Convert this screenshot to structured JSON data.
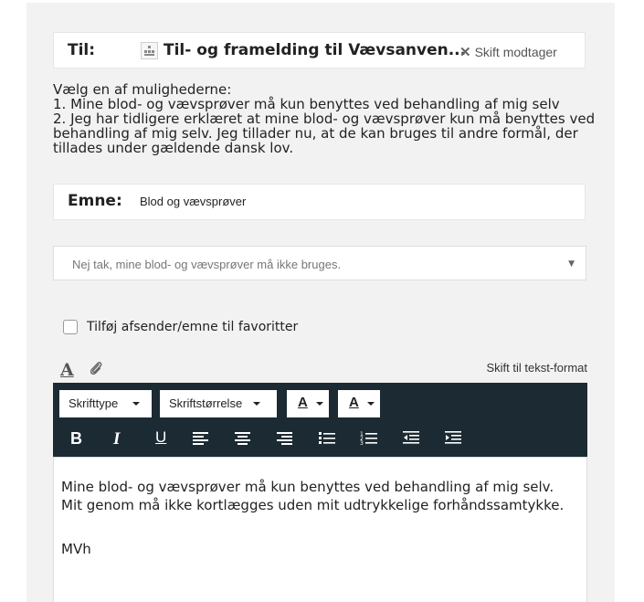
{
  "recipient": {
    "label": "Til:",
    "name": "Til- og framelding til Vævsanven...",
    "change_label": "Skift modtager"
  },
  "instructions": {
    "intro": "Vælg en af mulighederne:",
    "option1": "1. Mine blod- og vævsprøver må kun benyttes ved behandling af mig selv",
    "option2": "2. Jeg har tidligere erklæret at mine blod- og vævsprøver kun må benyttes ved behandling af mig selv. Jeg tillader nu, at de kan bruges til andre formål, der tillades under gældende dansk lov."
  },
  "subject": {
    "label": "Emne:",
    "value": "Blod og vævsprøver"
  },
  "choice_select": {
    "value": "Nej tak, mine blod- og vævsprøver må ikke bruges."
  },
  "favorites": {
    "label": "Tilføj afsender/emne til favoritter",
    "checked": false
  },
  "editor_header": {
    "format_icon": "A",
    "switch_label": "Skift til tekst-format"
  },
  "toolbar": {
    "font_type": "Skrifttype",
    "font_size": "Skriftstørrelse",
    "text_color_glyph": "A",
    "bg_color_glyph": "A",
    "bold_glyph": "B",
    "italic_glyph": "I",
    "underline_glyph": "U",
    "icons": [
      "bold-icon",
      "italic-icon",
      "underline-icon",
      "align-left-icon",
      "align-center-icon",
      "align-right-icon",
      "bullet-list-icon",
      "numbered-list-icon",
      "outdent-icon",
      "indent-icon"
    ]
  },
  "editor": {
    "body": "Mine blod- og vævsprøver må kun benyttes ved behandling af mig selv. Mit genom må ikke kortlægges uden mit udtrykkelige forhåndssamtykke.",
    "signature": "MVh"
  },
  "colors": {
    "toolbar_bg": "#1c2a33",
    "panel_bg": "#f2f2f2"
  }
}
